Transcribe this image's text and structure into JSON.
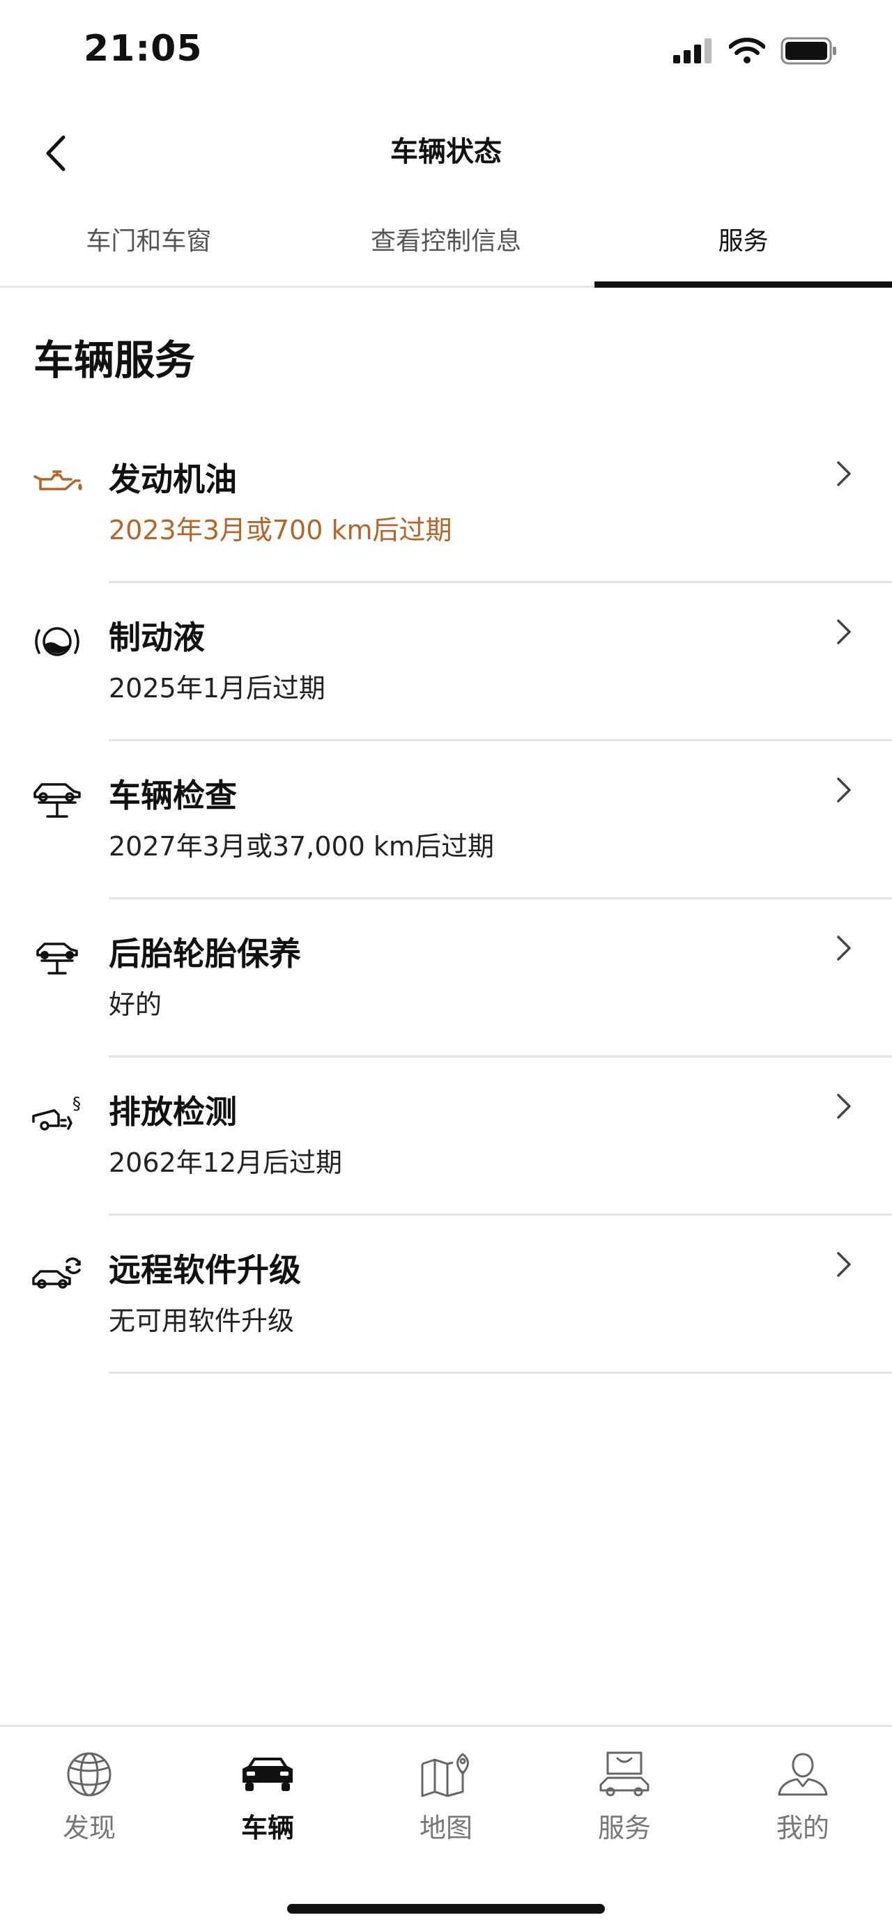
{
  "status_bar": {
    "time": "21:05"
  },
  "header": {
    "title": "车辆状态"
  },
  "tabs": [
    {
      "label": "车门和车窗",
      "active": false
    },
    {
      "label": "查看控制信息",
      "active": false
    },
    {
      "label": "服务",
      "active": true
    }
  ],
  "section_title": "车辆服务",
  "colors": {
    "warning": "#b5652a",
    "active_tab": "#111111"
  },
  "services": [
    {
      "name": "发动机油",
      "status": "2023年3月或700 km后过期",
      "icon": "oil-can-icon",
      "warning": true
    },
    {
      "name": "制动液",
      "status": "2025年1月后过期",
      "icon": "brake-fluid-icon",
      "warning": false
    },
    {
      "name": "车辆检查",
      "status": "2027年3月或37,000 km后过期",
      "icon": "car-lift-icon",
      "warning": false
    },
    {
      "name": "后胎轮胎保养",
      "status": "好的",
      "icon": "rear-tire-icon",
      "warning": false
    },
    {
      "name": "排放检测",
      "status": "2062年12月后过期",
      "icon": "exhaust-icon",
      "warning": false
    },
    {
      "name": "远程软件升级",
      "status": "无可用软件升级",
      "icon": "car-update-icon",
      "warning": false
    }
  ],
  "bottom_nav": [
    {
      "label": "发现",
      "icon": "globe-icon",
      "active": false
    },
    {
      "label": "车辆",
      "icon": "car-icon",
      "active": true
    },
    {
      "label": "地图",
      "icon": "map-icon",
      "active": false
    },
    {
      "label": "服务",
      "icon": "shopping-bag-icon",
      "active": false
    },
    {
      "label": "我的",
      "icon": "user-icon",
      "active": false
    }
  ]
}
